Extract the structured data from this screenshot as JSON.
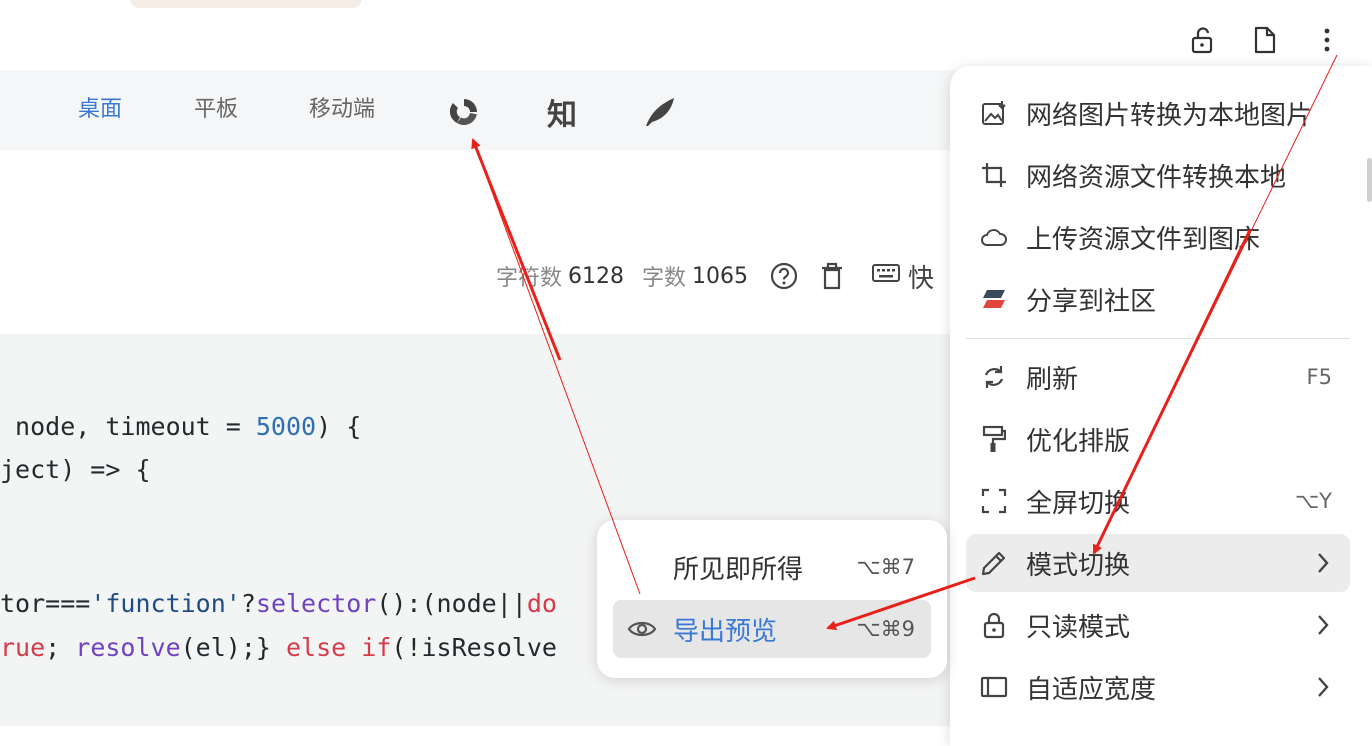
{
  "device_tabs": [
    {
      "label": "桌面",
      "active": true
    },
    {
      "label": "平板",
      "active": false
    },
    {
      "label": "移动端",
      "active": false
    }
  ],
  "platform_icons": [
    {
      "name": "sync-platform-icon",
      "label": ""
    },
    {
      "name": "zhihu-icon",
      "label": "知"
    },
    {
      "name": "feather-platform-icon",
      "label": ""
    }
  ],
  "top_icons": [
    "unlock-icon",
    "document-icon",
    "more-vertical-icon"
  ],
  "stats": {
    "char_label": "字符数",
    "char_count": "6128",
    "word_label": "字数",
    "word_count": "1065",
    "shortcut_label": "快"
  },
  "code_lines": [
    [
      {
        "t": " node, timeout = "
      },
      {
        "t": "5000",
        "c": "c-num"
      },
      {
        "t": ") {"
      }
    ],
    [
      {
        "t": "ject) => {"
      }
    ],
    [
      {
        "t": "tor==="
      },
      {
        "t": "'function'",
        "c": "c-str"
      },
      {
        "t": "?"
      },
      {
        "t": "selector",
        "c": "c-fn"
      },
      {
        "t": "():(node||"
      },
      {
        "t": "do",
        "c": "c-kw"
      }
    ],
    [
      {
        "t": "rue",
        "c": "c-kw"
      },
      {
        "t": "; "
      },
      {
        "t": "resolve",
        "c": "c-fn"
      },
      {
        "t": "(el);} "
      },
      {
        "t": "else",
        "c": "c-kw"
      },
      {
        "t": " "
      },
      {
        "t": "if",
        "c": "c-kw"
      },
      {
        "t": "(!isResolve"
      }
    ]
  ],
  "menu": {
    "items": [
      {
        "icon": "image-download-icon",
        "label": "网络图片转换为本地图片",
        "shortcut": "",
        "submenu": false
      },
      {
        "icon": "crop-icon",
        "label": "网络资源文件转换本地",
        "shortcut": "",
        "submenu": false
      },
      {
        "icon": "cloud-icon",
        "label": "上传资源文件到图床",
        "shortcut": "",
        "submenu": false
      },
      {
        "icon": "community-share-icon",
        "label": "分享到社区",
        "shortcut": "",
        "submenu": false
      },
      {
        "icon": "refresh-icon",
        "label": "刷新",
        "shortcut": "F5",
        "submenu": false
      },
      {
        "icon": "format-paint-icon",
        "label": "优化排版",
        "shortcut": "",
        "submenu": false
      },
      {
        "icon": "fullscreen-icon",
        "label": "全屏切换",
        "shortcut": "⌥Y",
        "submenu": false
      },
      {
        "icon": "pencil-icon",
        "label": "模式切换",
        "shortcut": "",
        "submenu": true,
        "highlighted": true
      },
      {
        "icon": "lock-icon",
        "label": "只读模式",
        "shortcut": "",
        "submenu": true
      },
      {
        "icon": "width-icon",
        "label": "自适应宽度",
        "shortcut": "",
        "submenu": true
      }
    ]
  },
  "submenu": {
    "items": [
      {
        "label": "所见即所得",
        "shortcut": "⌥⌘7",
        "selected": false
      },
      {
        "label": "导出预览",
        "shortcut": "⌥⌘9",
        "selected": true,
        "icon": "eye-icon"
      }
    ]
  },
  "colors": {
    "accent": "#3a78d6",
    "arrow": "#e8201a"
  }
}
